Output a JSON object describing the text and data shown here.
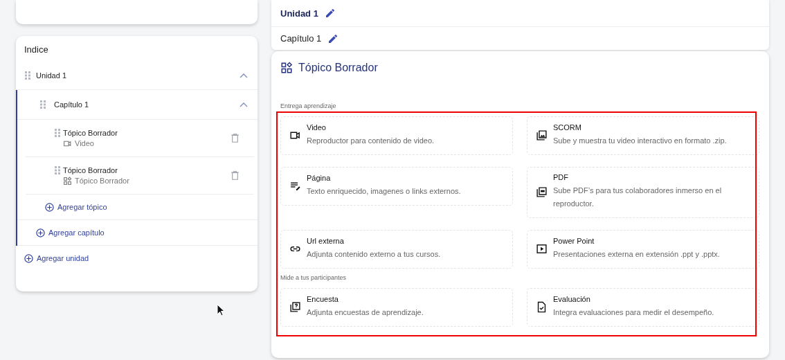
{
  "index": {
    "title": "Indice",
    "units": [
      {
        "label": "Unidad 1",
        "expanded": true,
        "children": [
          {
            "label": "Capítulo 1",
            "expanded": true,
            "children": [
              {
                "title": "Tópico Borrador",
                "kind": "video",
                "type_label": "Video"
              },
              {
                "title": "Tópico Borrador",
                "kind": "draft",
                "type_label": "Tópico Borrador"
              }
            ],
            "add_label": "Agregar tópico"
          }
        ],
        "add_label": "Agregar capítulo"
      }
    ],
    "add_label": "Agregar unidad"
  },
  "breadcrumb": {
    "unit": "Unidad 1",
    "chapter": "Capítulo 1"
  },
  "topic": {
    "title": "Tópico Borrador",
    "sections": [
      {
        "label": "Entrega aprendizaje",
        "items": [
          {
            "kind": "video",
            "title": "Video",
            "description": "Reproductor para contenido de video."
          },
          {
            "kind": "scorm",
            "title": "SCORM",
            "description": "Sube y muestra tu video interactivo en formato .zip."
          },
          {
            "kind": "page",
            "title": "Página",
            "description": "Texto enriquecido, imagenes o links externos."
          },
          {
            "kind": "pdf",
            "title": "PDF",
            "description": "Sube PDF’s para tus colaboradores inmerso en el reproductor."
          },
          {
            "kind": "url",
            "title": "Url externa",
            "description": "Adjunta contenido externo a tus cursos."
          },
          {
            "kind": "ppt",
            "title": "Power Point",
            "description": "Presentaciones externa en extensión .ppt y .pptx."
          }
        ]
      },
      {
        "label": "Mide a tus participantes",
        "items": [
          {
            "kind": "survey",
            "title": "Encuesta",
            "description": "Adjunta encuestas de aprendizaje."
          },
          {
            "kind": "eval",
            "title": "Evaluación",
            "description": "Integra evaluaciones para medir el desempeño."
          }
        ]
      }
    ]
  }
}
